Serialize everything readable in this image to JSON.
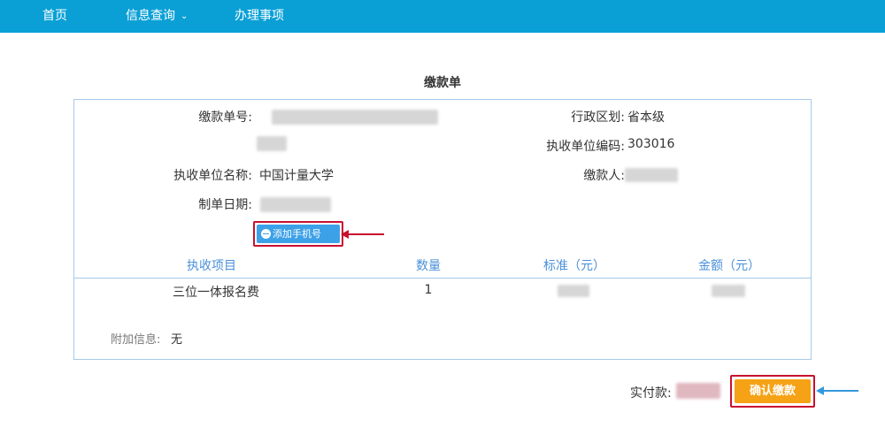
{
  "nav": {
    "home": "首页",
    "query": "信息查询",
    "query_chevron": "⌄",
    "services": "办理事项"
  },
  "form": {
    "title": "缴款单",
    "order_no_label": "缴款单号:",
    "region_label": "行政区划:",
    "region_value": "省本级",
    "unit_code_label": "执收单位编码:",
    "unit_code_value": "303016",
    "unit_name_label": "执收单位名称:",
    "unit_name_value": "中国计量大学",
    "payer_label": "缴款人:",
    "date_label": "制单日期:",
    "add_phone_button": "添加手机号",
    "table": {
      "headers": [
        "执收项目",
        "数量",
        "标准（元）",
        "金额（元）"
      ],
      "rows": [
        {
          "item": "三位一体报名费",
          "qty": "1"
        }
      ]
    },
    "extra_label": "附加信息:",
    "extra_value": "无"
  },
  "footer": {
    "paid_label": "实付款:",
    "confirm_button": "确认缴款"
  },
  "colors": {
    "nav_bg": "#0aa0d6",
    "accent_blue": "#3da1e8",
    "header_text": "#4a90d9",
    "confirm_orange": "#f5a216",
    "highlight_red": "#c8102e"
  }
}
